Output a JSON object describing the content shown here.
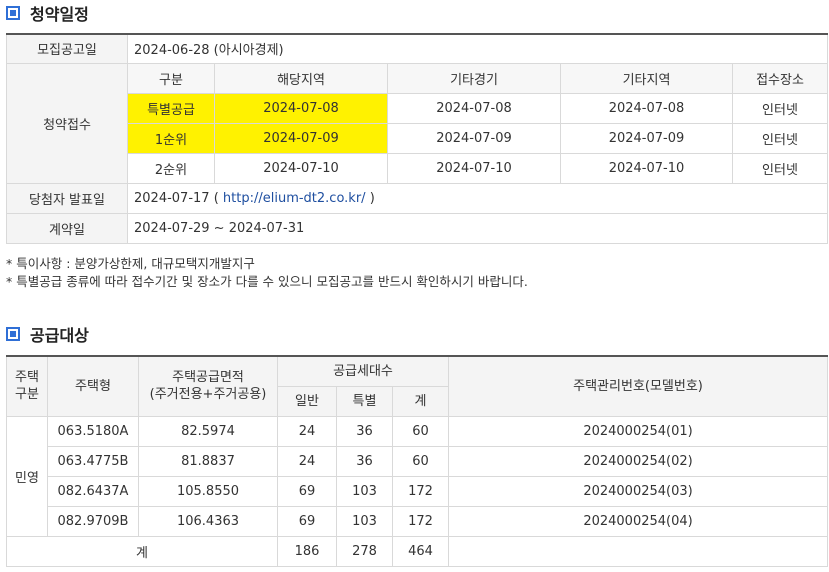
{
  "section1": {
    "title": "청약일정",
    "announce_label": "모집공고일",
    "announce_value": "2024-06-28 (아시아경제)",
    "apply_label": "청약접수",
    "headers": [
      "구분",
      "해당지역",
      "기타경기",
      "기타지역",
      "접수장소"
    ],
    "rows": [
      {
        "type": "특별공급",
        "local": "2024-07-08",
        "gyeonggi": "2024-07-08",
        "other": "2024-07-08",
        "place": "인터넷",
        "highlight": true
      },
      {
        "type": "1순위",
        "local": "2024-07-09",
        "gyeonggi": "2024-07-09",
        "other": "2024-07-09",
        "place": "인터넷",
        "highlight": true
      },
      {
        "type": "2순위",
        "local": "2024-07-10",
        "gyeonggi": "2024-07-10",
        "other": "2024-07-10",
        "place": "인터넷",
        "highlight": false
      }
    ],
    "winner_label": "당첨자 발표일",
    "winner_date": "2024-07-17",
    "winner_open": " ( ",
    "winner_link": "http://elium-dt2.co.kr/",
    "winner_close": " )",
    "contract_label": "계약일",
    "contract_value": "2024-07-29 ~ 2024-07-31"
  },
  "notes": [
    "* 특이사항 : 분양가상한제, 대규모택지개발지구",
    "* 특별공급 종류에 따라 접수기간 및 장소가 다를 수 있으니 모집공고를 반드시 확인하시기 바랍니다."
  ],
  "section2": {
    "title": "공급대상",
    "h_house_kind_1": "주택",
    "h_house_kind_2": "구분",
    "h_house_type": "주택형",
    "h_area_1": "주택공급면적",
    "h_area_2": "(주거전용+주거공용)",
    "h_units": "공급세대수",
    "h_general": "일반",
    "h_special": "특별",
    "h_total": "계",
    "h_mgmt": "주택관리번호(모델번호)",
    "kind": "민영",
    "rows": [
      {
        "type": "063.5180A",
        "area": "82.5974",
        "general": "24",
        "special": "36",
        "total": "60",
        "mgmt": "2024000254(01)"
      },
      {
        "type": "063.4775B",
        "area": "81.8837",
        "general": "24",
        "special": "36",
        "total": "60",
        "mgmt": "2024000254(02)"
      },
      {
        "type": "082.6437A",
        "area": "105.8550",
        "general": "69",
        "special": "103",
        "total": "172",
        "mgmt": "2024000254(03)"
      },
      {
        "type": "082.9709B",
        "area": "106.4363",
        "general": "69",
        "special": "103",
        "total": "172",
        "mgmt": "2024000254(04)"
      }
    ],
    "sum_label": "계",
    "sum_general": "186",
    "sum_special": "278",
    "sum_total": "464"
  },
  "colors": {
    "accent": "#2f6fd6",
    "highlight": "#fff200",
    "link": "#1f4fa0"
  }
}
